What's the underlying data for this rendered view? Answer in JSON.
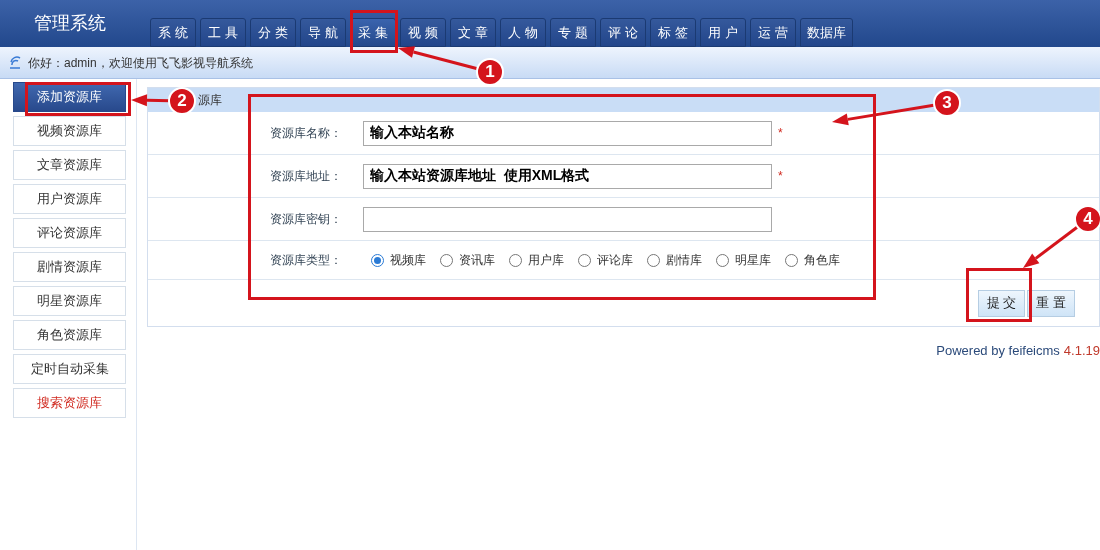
{
  "header": {
    "title": "管理系统",
    "tabs": [
      {
        "label": "系 统",
        "selected": false
      },
      {
        "label": "工 具",
        "selected": false
      },
      {
        "label": "分 类",
        "selected": false
      },
      {
        "label": "导 航",
        "selected": false
      },
      {
        "label": "采 集",
        "selected": true
      },
      {
        "label": "视 频",
        "selected": false
      },
      {
        "label": "文 章",
        "selected": false
      },
      {
        "label": "人 物",
        "selected": false
      },
      {
        "label": "专 题",
        "selected": false
      },
      {
        "label": "评 论",
        "selected": false
      },
      {
        "label": "标 签",
        "selected": false
      },
      {
        "label": "用 户",
        "selected": false
      },
      {
        "label": "运 营",
        "selected": false
      },
      {
        "label": "数据库",
        "selected": false
      }
    ]
  },
  "welcome": "你好：admin，欢迎使用飞飞影视导航系统",
  "sidebar": {
    "items": [
      {
        "label": "添加资源库",
        "selected": true,
        "kind": "normal"
      },
      {
        "label": "视频资源库",
        "selected": false,
        "kind": "normal"
      },
      {
        "label": "文章资源库",
        "selected": false,
        "kind": "normal"
      },
      {
        "label": "用户资源库",
        "selected": false,
        "kind": "normal"
      },
      {
        "label": "评论资源库",
        "selected": false,
        "kind": "normal"
      },
      {
        "label": "剧情资源库",
        "selected": false,
        "kind": "normal"
      },
      {
        "label": "明星资源库",
        "selected": false,
        "kind": "normal"
      },
      {
        "label": "角色资源库",
        "selected": false,
        "kind": "normal"
      },
      {
        "label": "定时自动采集",
        "selected": false,
        "kind": "normal"
      },
      {
        "label": "搜索资源库",
        "selected": false,
        "kind": "alert"
      }
    ]
  },
  "panel": {
    "title": "源库",
    "fields": [
      {
        "kind": "text",
        "label": "资源库名称：",
        "value": "输入本站名称",
        "required": true
      },
      {
        "kind": "text",
        "label": "资源库地址：",
        "value": "输入本站资源库地址  使用XML格式",
        "required": true
      },
      {
        "kind": "text",
        "label": "资源库密钥：",
        "required": false
      },
      {
        "kind": "radio",
        "label": "资源库类型：",
        "options": [
          {
            "label": "视频库",
            "selected": true
          },
          {
            "label": "资讯库",
            "selected": false
          },
          {
            "label": "用户库",
            "selected": false
          },
          {
            "label": "评论库",
            "selected": false
          },
          {
            "label": "剧情库",
            "selected": false
          },
          {
            "label": "明星库",
            "selected": false
          },
          {
            "label": "角色库",
            "selected": false
          }
        ]
      }
    ],
    "buttons": [
      "提 交",
      "重 置"
    ],
    "required_mark": "*"
  },
  "footer": {
    "text": "Powered by feifeicms",
    "version": "4.1.19"
  },
  "annotations": [
    "1",
    "2",
    "3",
    "4"
  ]
}
